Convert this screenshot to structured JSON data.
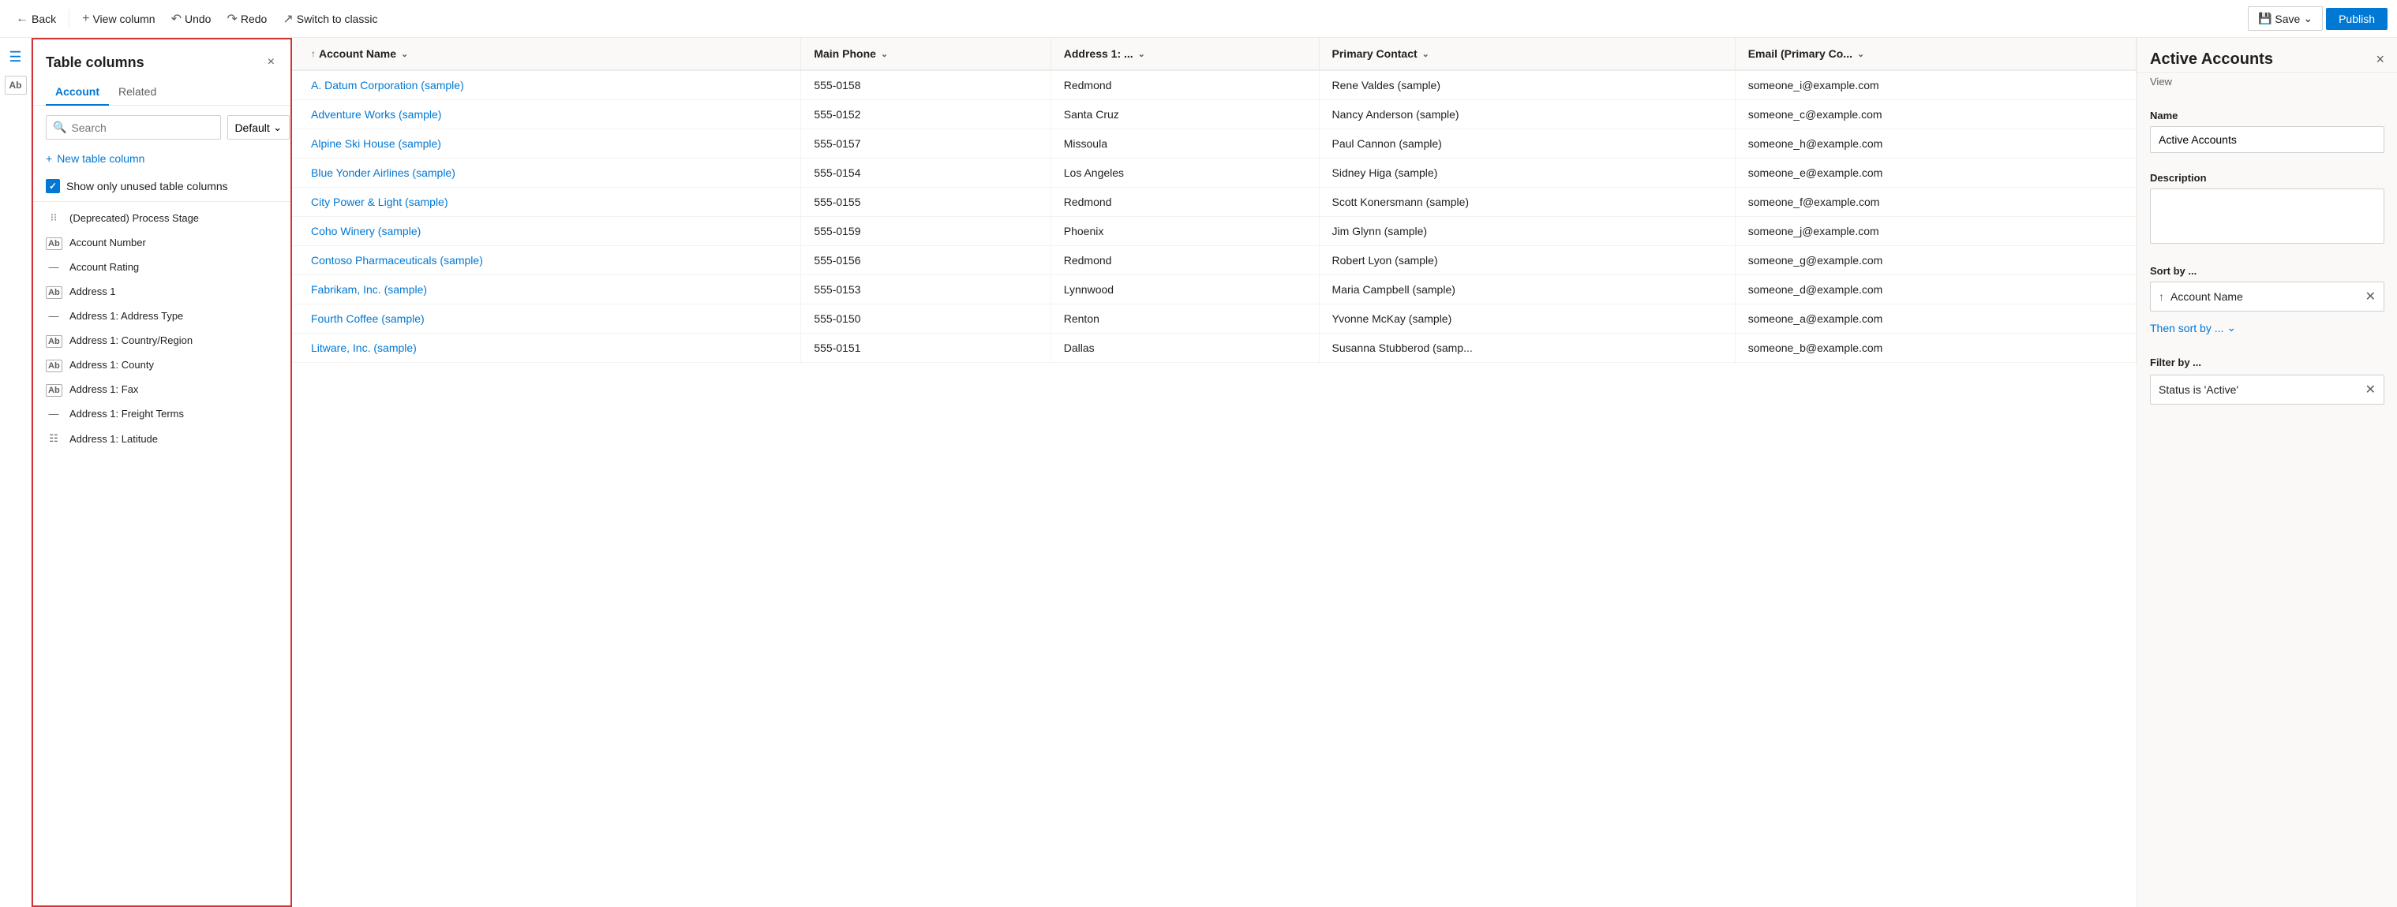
{
  "toolbar": {
    "back_label": "Back",
    "view_column_label": "View column",
    "undo_label": "Undo",
    "redo_label": "Redo",
    "switch_classic_label": "Switch to classic",
    "save_label": "Save",
    "publish_label": "Publish"
  },
  "columns_panel": {
    "title": "Table columns",
    "close_icon": "×",
    "tab_account": "Account",
    "tab_related": "Related",
    "search_placeholder": "Search",
    "default_label": "Default",
    "new_column_label": "New table column",
    "show_unused_label": "Show only unused table columns",
    "columns": [
      {
        "icon": "grid",
        "name": "(Deprecated) Process Stage"
      },
      {
        "icon": "abc",
        "name": "Account Number"
      },
      {
        "icon": "dash",
        "name": "Account Rating"
      },
      {
        "icon": "abc",
        "name": "Address 1"
      },
      {
        "icon": "dash",
        "name": "Address 1: Address Type"
      },
      {
        "icon": "abc",
        "name": "Address 1: Country/Region"
      },
      {
        "icon": "abc",
        "name": "Address 1: County"
      },
      {
        "icon": "abc",
        "name": "Address 1: Fax"
      },
      {
        "icon": "dash",
        "name": "Address 1: Freight Terms"
      },
      {
        "icon": "grid2",
        "name": "Address 1: Latitude"
      }
    ]
  },
  "table": {
    "columns": [
      {
        "label": "Account Name",
        "sort": true,
        "chevron": true
      },
      {
        "label": "Main Phone",
        "chevron": true
      },
      {
        "label": "Address 1: ...",
        "chevron": true
      },
      {
        "label": "Primary Contact",
        "chevron": true
      },
      {
        "label": "Email (Primary Co...",
        "chevron": true
      }
    ],
    "rows": [
      {
        "account": "A. Datum Corporation (sample)",
        "phone": "555-0158",
        "address": "Redmond",
        "contact": "Rene Valdes (sample)",
        "email": "someone_i@example.com"
      },
      {
        "account": "Adventure Works (sample)",
        "phone": "555-0152",
        "address": "Santa Cruz",
        "contact": "Nancy Anderson (sample)",
        "email": "someone_c@example.com"
      },
      {
        "account": "Alpine Ski House (sample)",
        "phone": "555-0157",
        "address": "Missoula",
        "contact": "Paul Cannon (sample)",
        "email": "someone_h@example.com"
      },
      {
        "account": "Blue Yonder Airlines (sample)",
        "phone": "555-0154",
        "address": "Los Angeles",
        "contact": "Sidney Higa (sample)",
        "email": "someone_e@example.com"
      },
      {
        "account": "City Power & Light (sample)",
        "phone": "555-0155",
        "address": "Redmond",
        "contact": "Scott Konersmann (sample)",
        "email": "someone_f@example.com"
      },
      {
        "account": "Coho Winery (sample)",
        "phone": "555-0159",
        "address": "Phoenix",
        "contact": "Jim Glynn (sample)",
        "email": "someone_j@example.com"
      },
      {
        "account": "Contoso Pharmaceuticals (sample)",
        "phone": "555-0156",
        "address": "Redmond",
        "contact": "Robert Lyon (sample)",
        "email": "someone_g@example.com"
      },
      {
        "account": "Fabrikam, Inc. (sample)",
        "phone": "555-0153",
        "address": "Lynnwood",
        "contact": "Maria Campbell (sample)",
        "email": "someone_d@example.com"
      },
      {
        "account": "Fourth Coffee (sample)",
        "phone": "555-0150",
        "address": "Renton",
        "contact": "Yvonne McKay (sample)",
        "email": "someone_a@example.com"
      },
      {
        "account": "Litware, Inc. (sample)",
        "phone": "555-0151",
        "address": "Dallas",
        "contact": "Susanna Stubberod (samp...",
        "email": "someone_b@example.com"
      }
    ]
  },
  "right_panel": {
    "title": "Active Accounts",
    "close_icon": "×",
    "view_label": "View",
    "name_label": "Name",
    "name_value": "Active Accounts",
    "description_label": "Description",
    "description_placeholder": "",
    "sort_label": "Sort by ...",
    "sort_field": "Account Name",
    "sort_icon": "↑",
    "then_sort_label": "Then sort by ...",
    "filter_label": "Filter by ...",
    "filter_value": "Status is 'Active'",
    "account_name_label": "Account Name"
  }
}
